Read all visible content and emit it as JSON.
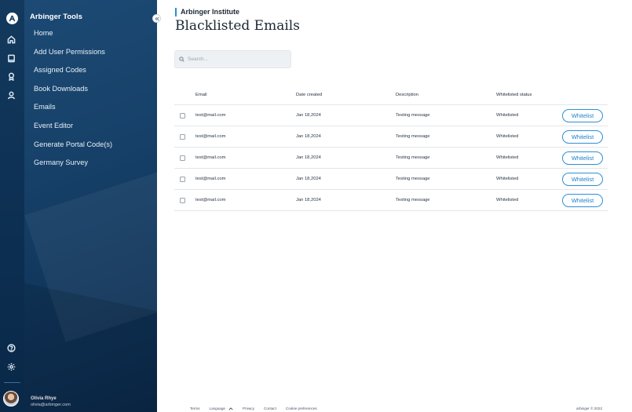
{
  "sidebar": {
    "title": "Arbinger Tools",
    "items": [
      {
        "label": "Home"
      },
      {
        "label": "Add User Permissions"
      },
      {
        "label": "Assigned Codes"
      },
      {
        "label": "Book Downloads"
      },
      {
        "label": "Emails"
      },
      {
        "label": "Event Editor"
      },
      {
        "label": "Generate Portal Code(s)"
      },
      {
        "label": "Germany Survey"
      }
    ],
    "user": {
      "name": "Olivia Rhye",
      "email": "olivia@arbinger.com"
    }
  },
  "rail": {
    "icons": [
      "logo-a-icon",
      "home-icon",
      "book-icon",
      "award-icon",
      "user-icon",
      "help-icon",
      "gear-icon"
    ]
  },
  "header": {
    "org": "Arbinger Institute",
    "title": "Blacklisted Emails",
    "accent_color": "#2d8fd6"
  },
  "search": {
    "placeholder": "Search...",
    "value": ""
  },
  "table": {
    "columns": {
      "email": "Email",
      "date_created": "Date created",
      "description": "Description",
      "status": "Whitelisted status"
    },
    "action_label": "Whitelist",
    "rows": [
      {
        "email": "test@mail.com",
        "date": "Jan 18,2024",
        "description": "Testing message",
        "status": "Whitelisted"
      },
      {
        "email": "test@mail.com",
        "date": "Jan 18,2024",
        "description": "Testing message",
        "status": "Whitelisted"
      },
      {
        "email": "test@mail.com",
        "date": "Jan 18,2024",
        "description": "Testing message",
        "status": "Whitelisted"
      },
      {
        "email": "test@mail.com",
        "date": "Jan 18,2024",
        "description": "Testing message",
        "status": "Whitelisted"
      },
      {
        "email": "test@mail.com",
        "date": "Jan 18,2024",
        "description": "Testing message",
        "status": "Whitelisted"
      }
    ]
  },
  "footer": {
    "terms": "Terms",
    "language": "Language",
    "privacy": "Privacy",
    "contact": "Contact",
    "cookies": "Cookie preferences",
    "copyright": "arbinger © 2022"
  }
}
